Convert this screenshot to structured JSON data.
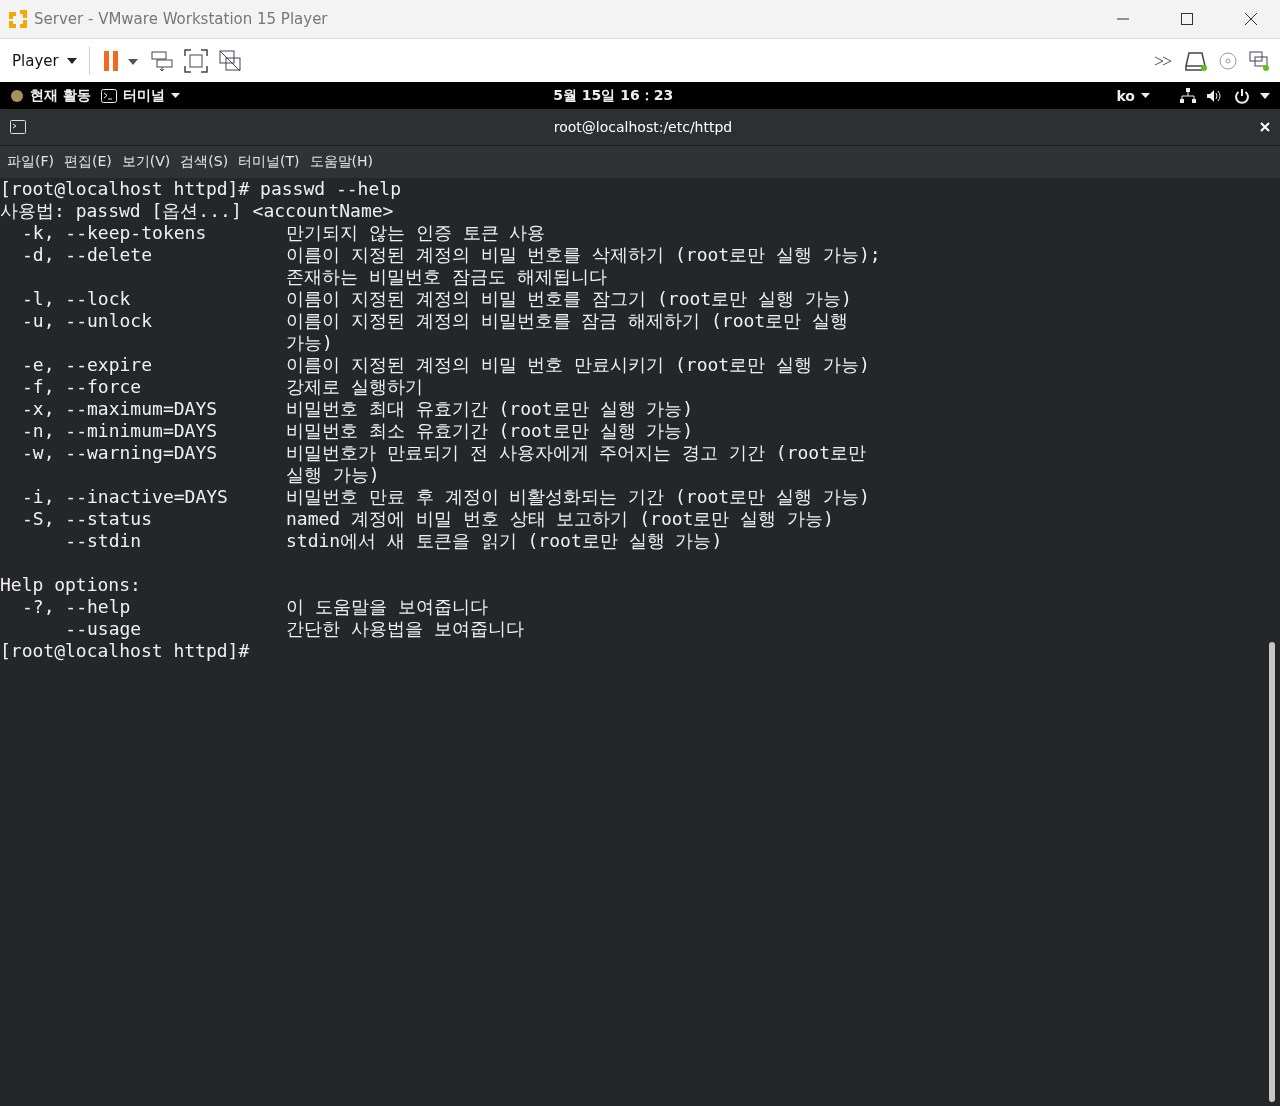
{
  "window": {
    "title": "Server - VMware Workstation 15 Player"
  },
  "toolbar": {
    "player_menu": "Player"
  },
  "gnome_bar": {
    "activities": "현재 활동",
    "app_menu": "터미널",
    "clock": "5월 15일 16：23",
    "input_language": "ko"
  },
  "terminal": {
    "title": "root@localhost:/etc/httpd",
    "menu": [
      "파일(F)",
      "편집(E)",
      "보기(V)",
      "검색(S)",
      "터미널(T)",
      "도움말(H)"
    ],
    "lines": [
      {
        "kind": "text",
        "text": "[root@localhost httpd]# passwd --help"
      },
      {
        "kind": "text",
        "text": "사용법: passwd [옵션...] <accountName>"
      },
      {
        "kind": "option",
        "option": "-k, --keep-tokens",
        "desc": "만기되지 않는 인증 토큰 사용"
      },
      {
        "kind": "option",
        "option": "-d, --delete",
        "desc": "이름이 지정된 계정의 비밀 번호를 삭제하기 (root로만 실행 가능);"
      },
      {
        "kind": "option",
        "desc": "존재하는 비밀번호 잠금도 해제됩니다"
      },
      {
        "kind": "option",
        "option": "-l, --lock",
        "desc": "이름이 지정된 계정의 비밀 번호를 잠그기 (root로만 실행 가능)"
      },
      {
        "kind": "option",
        "option": "-u, --unlock",
        "desc": "이름이 지정된 계정의 비밀번호를 잠금 해제하기 (root로만 실행"
      },
      {
        "kind": "option",
        "desc": "가능)"
      },
      {
        "kind": "option",
        "option": "-e, --expire",
        "desc": "이름이 지정된 계정의 비밀 번호 만료시키기 (root로만 실행 가능)"
      },
      {
        "kind": "option",
        "option": "-f, --force",
        "desc": "강제로 실행하기"
      },
      {
        "kind": "option",
        "option": "-x, --maximum=DAYS",
        "desc": "비밀번호 최대 유효기간 (root로만 실행 가능)"
      },
      {
        "kind": "option",
        "option": "-n, --minimum=DAYS",
        "desc": "비밀번호 최소 유효기간 (root로만 실행 가능)"
      },
      {
        "kind": "option",
        "option": "-w, --warning=DAYS",
        "desc": "비밀번호가 만료되기 전 사용자에게 주어지는 경고 기간 (root로만"
      },
      {
        "kind": "option",
        "desc": "실행 가능)"
      },
      {
        "kind": "option",
        "option": "-i, --inactive=DAYS",
        "desc": "비밀번호 만료 후 계정이 비활성화되는 기간 (root로만 실행 가능)"
      },
      {
        "kind": "option",
        "option": "-S, --status",
        "desc": "named 계정에 비밀 번호 상태 보고하기 (root로만 실행 가능)"
      },
      {
        "kind": "option",
        "option": "    --stdin",
        "desc": "stdin에서 새 토큰을 읽기 (root로만 실행 가능)"
      },
      {
        "kind": "blank"
      },
      {
        "kind": "text",
        "text": "Help options:"
      },
      {
        "kind": "option",
        "option": "-?, --help",
        "desc": "이 도움말을 보여줍니다"
      },
      {
        "kind": "option",
        "option": "    --usage",
        "desc": "간단한 사용법을 보여줍니다"
      },
      {
        "kind": "text",
        "text": "[root@localhost httpd]#"
      }
    ]
  }
}
